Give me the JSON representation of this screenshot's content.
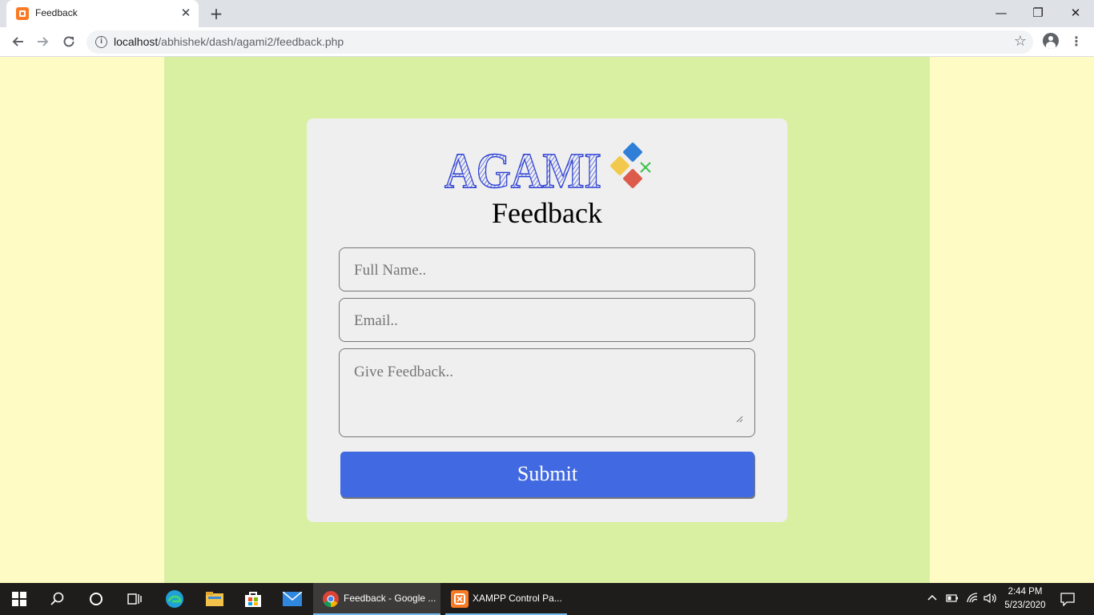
{
  "browser": {
    "tab_title": "Feedback",
    "tab_close": "✕",
    "new_tab": "+",
    "url_host": "localhost",
    "url_path": "/abhishek/dash/agami2/feedback.php",
    "window_controls": {
      "minimize": "—",
      "maximize": "❐",
      "close": "✕"
    }
  },
  "page": {
    "logo_text": "AGAMI",
    "title": "Feedback",
    "form": {
      "name_placeholder": "Full Name..",
      "email_placeholder": "Email..",
      "feedback_placeholder": "Give Feedback..",
      "submit_label": "Submit"
    }
  },
  "taskbar": {
    "apps": [
      {
        "label": "Feedback - Google ...",
        "icon": "chrome-icon"
      },
      {
        "label": "XAMPP Control Pa...",
        "icon": "xampp-icon"
      }
    ],
    "clock_time": "2:44 PM",
    "clock_date": "5/23/2020"
  },
  "colors": {
    "outer_bg": "#fffbc4",
    "panel_bg": "#d9f0a3",
    "card_bg": "#efefef",
    "submit_bg": "#4169e1",
    "logo_blue": "#2b3fd6"
  }
}
